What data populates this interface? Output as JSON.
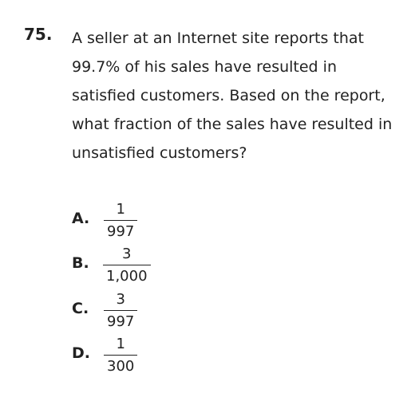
{
  "question": {
    "number": "75.",
    "lines": [
      "A seller at an Internet site reports that",
      "99.7% of his sales have resulted in",
      "satisfied customers. Based on the report,",
      "what fraction of the sales have resulted in",
      "unsatisfied customers?"
    ]
  },
  "choices": [
    {
      "letter": "A.",
      "numerator": "1",
      "denominator": "997"
    },
    {
      "letter": "B.",
      "numerator": "3",
      "denominator": "1,000"
    },
    {
      "letter": "C.",
      "numerator": "3",
      "denominator": "997"
    },
    {
      "letter": "D.",
      "numerator": "1",
      "denominator": "300"
    }
  ]
}
